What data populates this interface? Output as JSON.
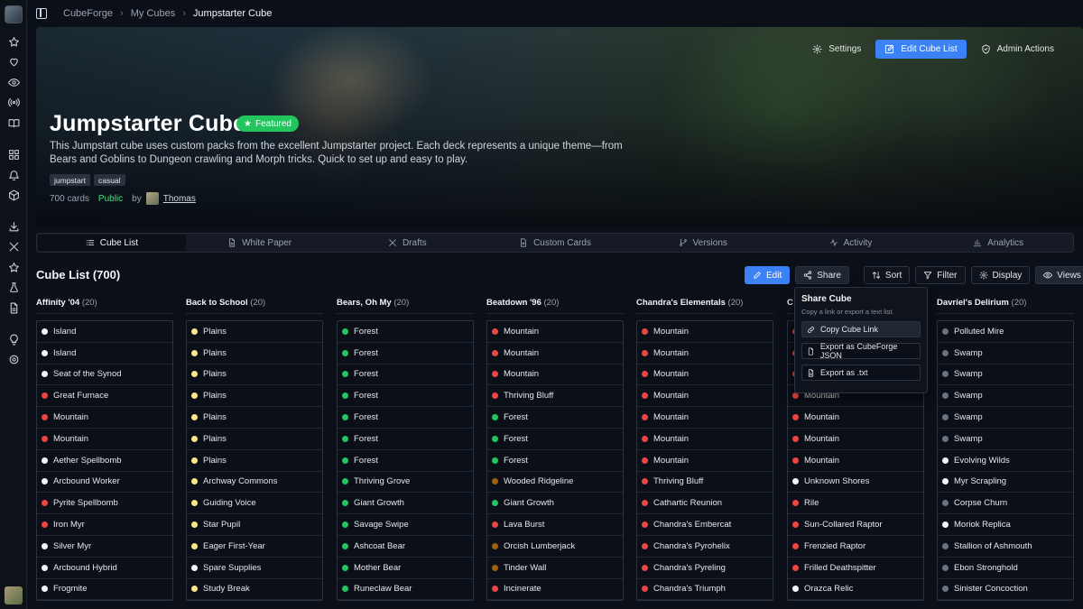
{
  "sidebar": {
    "icons": [
      "star-icon",
      "heart-icon",
      "eye-icon",
      "broadcast-icon",
      "book-icon",
      "grid-icon",
      "bell-icon",
      "cube-icon",
      "download-icon",
      "swords-icon",
      "star-icon",
      "flask-icon",
      "document-icon",
      "lightbulb-icon",
      "settings-icon"
    ]
  },
  "breadcrumb": {
    "items": [
      "CubeForge",
      "My Cubes"
    ],
    "current": "Jumpstarter Cube"
  },
  "hero": {
    "title": "Jumpstarter Cube",
    "badge": "Featured",
    "description": "This Jumpstart cube uses custom packs from the excellent Jumpstarter project. Each deck represents a unique theme—from Bears and Goblins to Dungeon crawling and Morph tricks. Quick to set up and easy to play.",
    "tags": [
      "jumpstart",
      "casual"
    ],
    "card_count": "700 cards",
    "visibility": "Public",
    "by_label": "by",
    "owner": "Thomas",
    "actions": {
      "settings": "Settings",
      "edit": "Edit Cube List",
      "admin": "Admin Actions"
    }
  },
  "tabs": [
    "Cube List",
    "White Paper",
    "Drafts",
    "Custom Cards",
    "Versions",
    "Activity",
    "Analytics"
  ],
  "list": {
    "title": "Cube List (700)",
    "actions": {
      "edit": "Edit",
      "share": "Share",
      "sort": "Sort",
      "filter": "Filter",
      "display": "Display",
      "views": "Views"
    }
  },
  "share_menu": {
    "title": "Share Cube",
    "subtitle": "Copy a link or export a text list.",
    "items": [
      "Copy Cube Link",
      "Export as CubeForge JSON",
      "Export as .txt"
    ]
  },
  "colors": {
    "white": "#f3f4f6",
    "red": "#ef4444",
    "green": "#22c55e",
    "gold": "#fde68a",
    "multi": "#a16207",
    "colorless": "#6b7280",
    "accent": "#3b82f6"
  },
  "columns": [
    {
      "name": "Affinity '04",
      "count": "(20)",
      "cards": [
        {
          "n": "Island",
          "c": "white"
        },
        {
          "n": "Island",
          "c": "white"
        },
        {
          "n": "Seat of the Synod",
          "c": "white"
        },
        {
          "n": "Great Furnace",
          "c": "red"
        },
        {
          "n": "Mountain",
          "c": "red"
        },
        {
          "n": "Mountain",
          "c": "red"
        },
        {
          "n": "Aether Spellbomb",
          "c": "white"
        },
        {
          "n": "Arcbound Worker",
          "c": "white"
        },
        {
          "n": "Pyrite Spellbomb",
          "c": "red"
        },
        {
          "n": "Iron Myr",
          "c": "red"
        },
        {
          "n": "Silver Myr",
          "c": "white"
        },
        {
          "n": "Arcbound Hybrid",
          "c": "white"
        },
        {
          "n": "Frogmite",
          "c": "white"
        }
      ]
    },
    {
      "name": "Back to School",
      "count": "(20)",
      "cards": [
        {
          "n": "Plains",
          "c": "gold"
        },
        {
          "n": "Plains",
          "c": "gold"
        },
        {
          "n": "Plains",
          "c": "gold"
        },
        {
          "n": "Plains",
          "c": "gold"
        },
        {
          "n": "Plains",
          "c": "gold"
        },
        {
          "n": "Plains",
          "c": "gold"
        },
        {
          "n": "Plains",
          "c": "gold"
        },
        {
          "n": "Archway Commons",
          "c": "gold"
        },
        {
          "n": "Guiding Voice",
          "c": "gold"
        },
        {
          "n": "Star Pupil",
          "c": "gold"
        },
        {
          "n": "Eager First-Year",
          "c": "gold"
        },
        {
          "n": "Spare Supplies",
          "c": "white"
        },
        {
          "n": "Study Break",
          "c": "gold"
        }
      ]
    },
    {
      "name": "Bears, Oh My",
      "count": "(20)",
      "cards": [
        {
          "n": "Forest",
          "c": "green"
        },
        {
          "n": "Forest",
          "c": "green"
        },
        {
          "n": "Forest",
          "c": "green"
        },
        {
          "n": "Forest",
          "c": "green"
        },
        {
          "n": "Forest",
          "c": "green"
        },
        {
          "n": "Forest",
          "c": "green"
        },
        {
          "n": "Forest",
          "c": "green"
        },
        {
          "n": "Thriving Grove",
          "c": "green"
        },
        {
          "n": "Giant Growth",
          "c": "green"
        },
        {
          "n": "Savage Swipe",
          "c": "green"
        },
        {
          "n": "Ashcoat Bear",
          "c": "green"
        },
        {
          "n": "Mother Bear",
          "c": "green"
        },
        {
          "n": "Runeclaw Bear",
          "c": "green"
        }
      ]
    },
    {
      "name": "Beatdown '96",
      "count": "(20)",
      "cards": [
        {
          "n": "Mountain",
          "c": "red"
        },
        {
          "n": "Mountain",
          "c": "red"
        },
        {
          "n": "Mountain",
          "c": "red"
        },
        {
          "n": "Thriving Bluff",
          "c": "red"
        },
        {
          "n": "Forest",
          "c": "green"
        },
        {
          "n": "Forest",
          "c": "green"
        },
        {
          "n": "Forest",
          "c": "green"
        },
        {
          "n": "Wooded Ridgeline",
          "c": "multi"
        },
        {
          "n": "Giant Growth",
          "c": "green"
        },
        {
          "n": "Lava Burst",
          "c": "red"
        },
        {
          "n": "Orcish Lumberjack",
          "c": "multi"
        },
        {
          "n": "Tinder Wall",
          "c": "multi"
        },
        {
          "n": "Incinerate",
          "c": "red"
        }
      ]
    },
    {
      "name": "Chandra's Elementals",
      "count": "(20)",
      "cards": [
        {
          "n": "Mountain",
          "c": "red"
        },
        {
          "n": "Mountain",
          "c": "red"
        },
        {
          "n": "Mountain",
          "c": "red"
        },
        {
          "n": "Mountain",
          "c": "red"
        },
        {
          "n": "Mountain",
          "c": "red"
        },
        {
          "n": "Mountain",
          "c": "red"
        },
        {
          "n": "Mountain",
          "c": "red"
        },
        {
          "n": "Thriving Bluff",
          "c": "red"
        },
        {
          "n": "Cathartic Reunion",
          "c": "red"
        },
        {
          "n": "Chandra's Embercat",
          "c": "red"
        },
        {
          "n": "Chandra's Pyrohelix",
          "c": "red"
        },
        {
          "n": "Chandra's Pyreling",
          "c": "red"
        },
        {
          "n": "Chandra's Triumph",
          "c": "red"
        }
      ]
    },
    {
      "name": "C",
      "count": "",
      "cards": [
        {
          "n": "Mountain",
          "c": "red"
        },
        {
          "n": "Mountain",
          "c": "red"
        },
        {
          "n": "Mountain",
          "c": "red"
        },
        {
          "n": "Mountain",
          "c": "red"
        },
        {
          "n": "Mountain",
          "c": "red"
        },
        {
          "n": "Mountain",
          "c": "red"
        },
        {
          "n": "Mountain",
          "c": "red"
        },
        {
          "n": "Unknown Shores",
          "c": "white"
        },
        {
          "n": "Rile",
          "c": "red"
        },
        {
          "n": "Sun-Collared Raptor",
          "c": "red"
        },
        {
          "n": "Frenzied Raptor",
          "c": "red"
        },
        {
          "n": "Frilled Deathspitter",
          "c": "red"
        },
        {
          "n": "Orazca Relic",
          "c": "white"
        }
      ]
    },
    {
      "name": "Davriel's Delirium",
      "count": "(20)",
      "cards": [
        {
          "n": "Polluted Mire",
          "c": "colorless"
        },
        {
          "n": "Swamp",
          "c": "colorless"
        },
        {
          "n": "Swamp",
          "c": "colorless"
        },
        {
          "n": "Swamp",
          "c": "colorless"
        },
        {
          "n": "Swamp",
          "c": "colorless"
        },
        {
          "n": "Swamp",
          "c": "colorless"
        },
        {
          "n": "Evolving Wilds",
          "c": "white"
        },
        {
          "n": "Myr Scrapling",
          "c": "white"
        },
        {
          "n": "Corpse Churn",
          "c": "colorless"
        },
        {
          "n": "Moriok Replica",
          "c": "white"
        },
        {
          "n": "Stallion of Ashmouth",
          "c": "colorless"
        },
        {
          "n": "Ebon Stronghold",
          "c": "colorless"
        },
        {
          "n": "Sinister Concoction",
          "c": "colorless"
        }
      ]
    }
  ]
}
